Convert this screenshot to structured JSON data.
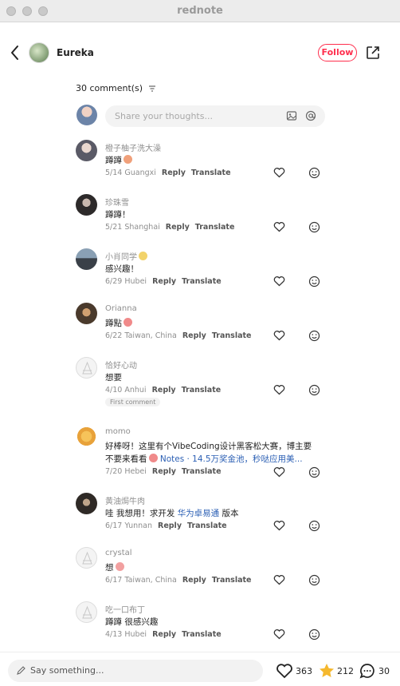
{
  "window": {
    "title": "rednote"
  },
  "header": {
    "author": "Eureka",
    "follow_label": "Follow"
  },
  "comments_header": {
    "count_label": "30 comment(s)",
    "input_placeholder": "Share your thoughts..."
  },
  "comments": [
    {
      "user": "橙子柚子洗大澡",
      "text": "蹲蹲",
      "emoji": "#f0a07a",
      "date": "5/14",
      "location": "Guangxi",
      "reply": "Reply",
      "translate": "Translate",
      "avatar": "#5a5a66"
    },
    {
      "user": "珍珠雪",
      "text": "蹲蹲！",
      "date": "5/21",
      "location": "Shanghai",
      "reply": "Reply",
      "translate": "Translate",
      "avatar": "#2d2a2a"
    },
    {
      "user": "小肖同学",
      "user_emoji": "#f2d36b",
      "text": "感兴趣！",
      "date": "6/29",
      "location": "Hubei",
      "reply": "Reply",
      "translate": "Translate",
      "avatar": "#3a4048"
    },
    {
      "user": "Orianna",
      "text": "蹲點",
      "emoji": "#f08a8a",
      "date": "6/22",
      "location": "Taiwan, China",
      "reply": "Reply",
      "translate": "Translate",
      "avatar": "#4a3a2c"
    },
    {
      "user": "恰好心动",
      "text": "想要",
      "date": "4/10",
      "location": "Anhui",
      "reply": "Reply",
      "translate": "Translate",
      "avatar": "#eeeeee",
      "badge": "First comment"
    },
    {
      "user": "momo",
      "text": "好棒呀！这里有个VibeCoding设计黑客松大赛，博主要",
      "text2_a": "不要来看看",
      "text2_link": "Notes · 14.5万奖金池，秒哒应用美...",
      "date": "7/20",
      "location": "Hebei",
      "reply": "Reply",
      "translate": "Translate",
      "avatar": "#e8a23a"
    },
    {
      "user": "黄油焗牛肉",
      "text": "哇 我想用！求开发 ",
      "link": "华为卓易通",
      "text_tail": " 版本",
      "date": "6/17",
      "location": "Yunnan",
      "reply": "Reply",
      "translate": "Translate",
      "avatar": "#2f2a26"
    },
    {
      "user": "crystal",
      "text": "想",
      "emoji": "#f2a0a0",
      "date": "6/17",
      "location": "Taiwan, China",
      "reply": "Reply",
      "translate": "Translate",
      "avatar": "#eeeeee"
    },
    {
      "user": "吃一口布丁",
      "text": "蹲蹲 很感兴趣",
      "date": "4/13",
      "location": "Hubei",
      "reply": "Reply",
      "translate": "Translate",
      "avatar": "#eeeeee"
    }
  ],
  "bottom_bar": {
    "say_placeholder": "Say something...",
    "likes": "363",
    "stars": "212",
    "comments": "30"
  },
  "colors": {
    "accent": "#ff2e4d",
    "star": "#f5b82e",
    "link": "#2b5fb4"
  }
}
